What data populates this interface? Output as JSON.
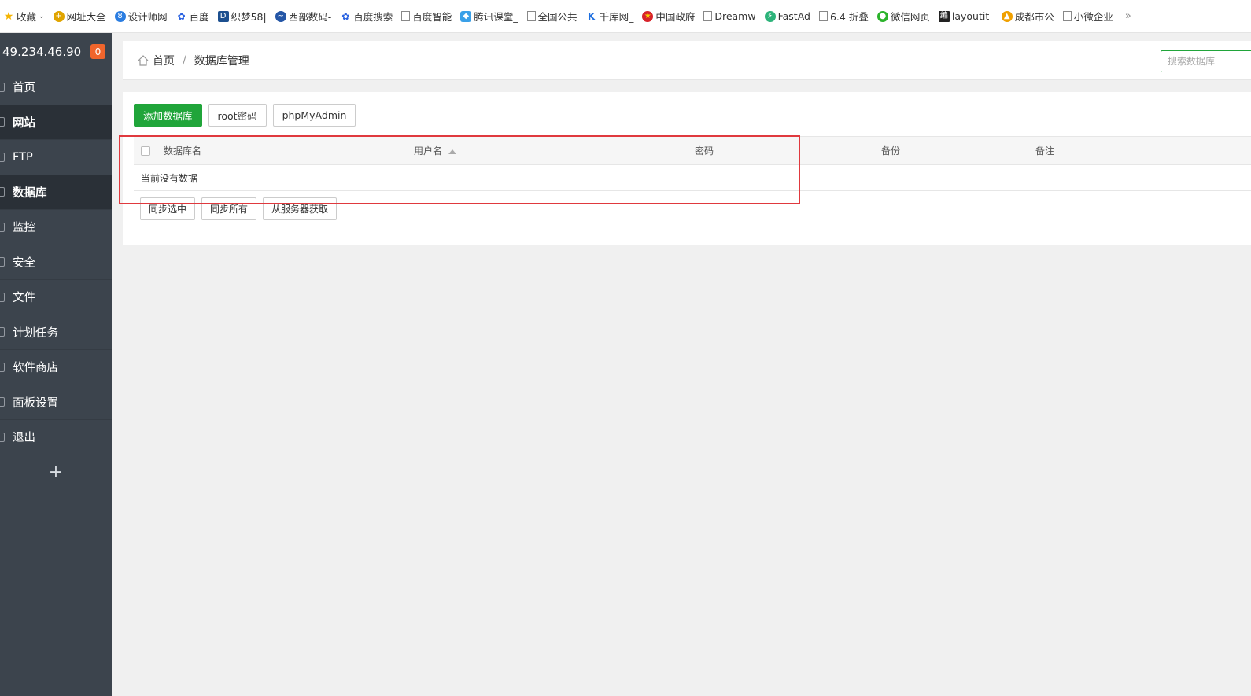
{
  "bookmarks": {
    "items": [
      {
        "label": "收藏",
        "icon": "star-icon"
      },
      {
        "label": "网址大全",
        "icon": "hao123-icon"
      },
      {
        "label": "设计师网",
        "icon": "designer-icon"
      },
      {
        "label": "百度",
        "icon": "baidu-paw-icon"
      },
      {
        "label": "织梦58|",
        "icon": "dede-icon"
      },
      {
        "label": "西部数码-",
        "icon": "west-icon"
      },
      {
        "label": "百度搜索",
        "icon": "baidu-paw-icon"
      },
      {
        "label": "百度智能",
        "icon": "page-icon"
      },
      {
        "label": "腾讯课堂_",
        "icon": "tencent-icon"
      },
      {
        "label": "全国公共",
        "icon": "page-icon"
      },
      {
        "label": "千库网_",
        "icon": "qianku-icon"
      },
      {
        "label": "中国政府",
        "icon": "emblem-icon"
      },
      {
        "label": "Dreamw",
        "icon": "page-icon"
      },
      {
        "label": "FastAd",
        "icon": "fastad-icon"
      },
      {
        "label": "6.4 折叠",
        "icon": "page-icon"
      },
      {
        "label": "微信网页",
        "icon": "wechat-icon"
      },
      {
        "label": "layoutit-",
        "icon": "layoutit-icon"
      },
      {
        "label": "成都市公",
        "icon": "chengdu-icon"
      },
      {
        "label": "小微企业",
        "icon": "page-icon"
      }
    ],
    "more": "»"
  },
  "sidebar": {
    "ip": "49.234.46.90",
    "badge": "0",
    "items": [
      {
        "label": "首页"
      },
      {
        "label": "网站"
      },
      {
        "label": "FTP"
      },
      {
        "label": "数据库"
      },
      {
        "label": "监控"
      },
      {
        "label": "安全"
      },
      {
        "label": "文件"
      },
      {
        "label": "计划任务"
      },
      {
        "label": "软件商店"
      },
      {
        "label": "面板设置"
      },
      {
        "label": "退出"
      }
    ],
    "add": "+"
  },
  "breadcrumb": {
    "home": "首页",
    "separator": "/",
    "current": "数据库管理"
  },
  "search": {
    "placeholder": "搜索数据库"
  },
  "toolbar": {
    "add_db": "添加数据库",
    "root_pw": "root密码",
    "phpmyadmin": "phpMyAdmin"
  },
  "table": {
    "headers": {
      "name": "数据库名",
      "user": "用户名",
      "password": "密码",
      "backup": "备份",
      "note": "备注"
    },
    "empty": "当前没有数据"
  },
  "actions": {
    "sync_selected": "同步选中",
    "sync_all": "同步所有",
    "fetch_server": "从服务器获取"
  },
  "colors": {
    "accent": "#20a53a",
    "sidebar": "#3c444d",
    "badge": "#f0652c",
    "highlight": "#e0393e"
  }
}
